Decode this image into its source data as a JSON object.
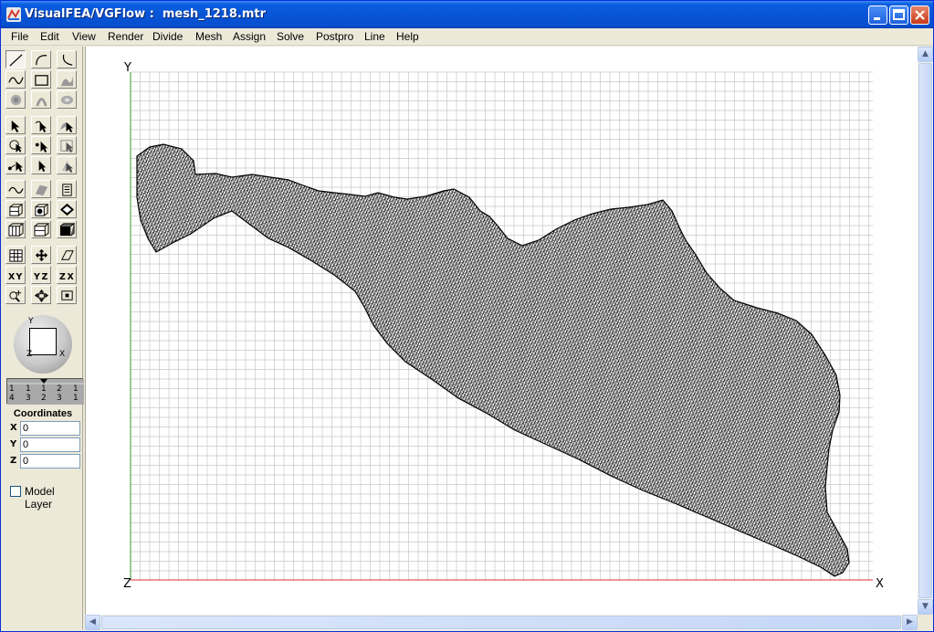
{
  "window": {
    "title": "VisualFEA/VGFlow :  mesh_1218.mtr",
    "minimize_icon": "minimize-icon",
    "maximize_icon": "maximize-icon",
    "close_icon": "close-icon"
  },
  "menu": [
    "File",
    "Edit",
    "View",
    "Render",
    "Divide",
    "Mesh",
    "Assign",
    "Solve",
    "Postpro",
    "Line",
    "Help"
  ],
  "toolbox": {
    "tools": [
      "line-tool-icon",
      "arc-tool-icon",
      "arc-ccw-tool-icon",
      "spline-tool-icon",
      "rectangle-tool-icon",
      "surface-sweep-icon",
      "circle-solid-icon",
      "extrude-icon",
      "torus-icon",
      "select-pointer-icon",
      "select-curve-icon",
      "select-surface-icon",
      "select-region-icon",
      "select-node-icon",
      "select-box-icon",
      "move-pointer-icon",
      "pick-arrow-icon",
      "pick-face-icon",
      "smooth-curve-icon",
      "surface-patch-icon",
      "layer-stack-icon",
      "cube-view-1-icon",
      "cube-view-2-icon",
      "cube-view-3-icon",
      "cube-iso-1-icon",
      "cube-iso-2-icon",
      "cube-iso-3-icon",
      "grid-cube-icon",
      "rotate-cube-icon",
      "plane-outline-icon",
      "view-xy-icon",
      "view-yz-icon",
      "view-zx-icon",
      "zoom-icon",
      "pan-icon",
      "fit-icon"
    ],
    "viewcube_axes": {
      "y": "Y",
      "x": "X",
      "z": "Z"
    },
    "ruler_labels": [
      "1",
      "1",
      "1",
      "2",
      "1",
      "4",
      "3",
      "2",
      "3",
      "1"
    ],
    "coordinates": {
      "title": "Coordinates",
      "x_label": "X",
      "y_label": "Y",
      "z_label": "Z",
      "x": "0",
      "y": "0",
      "z": "0"
    },
    "model_layer_label": "Model Layer",
    "model_layer_checked": false
  },
  "viewport": {
    "axis_y": "Y",
    "axis_x": "X",
    "axis_z": "Z",
    "grid_color": "#c8c8c8",
    "y_axis_color": "#2e9b2e",
    "x_axis_color": "#e03030",
    "mesh_color": "#000000"
  }
}
